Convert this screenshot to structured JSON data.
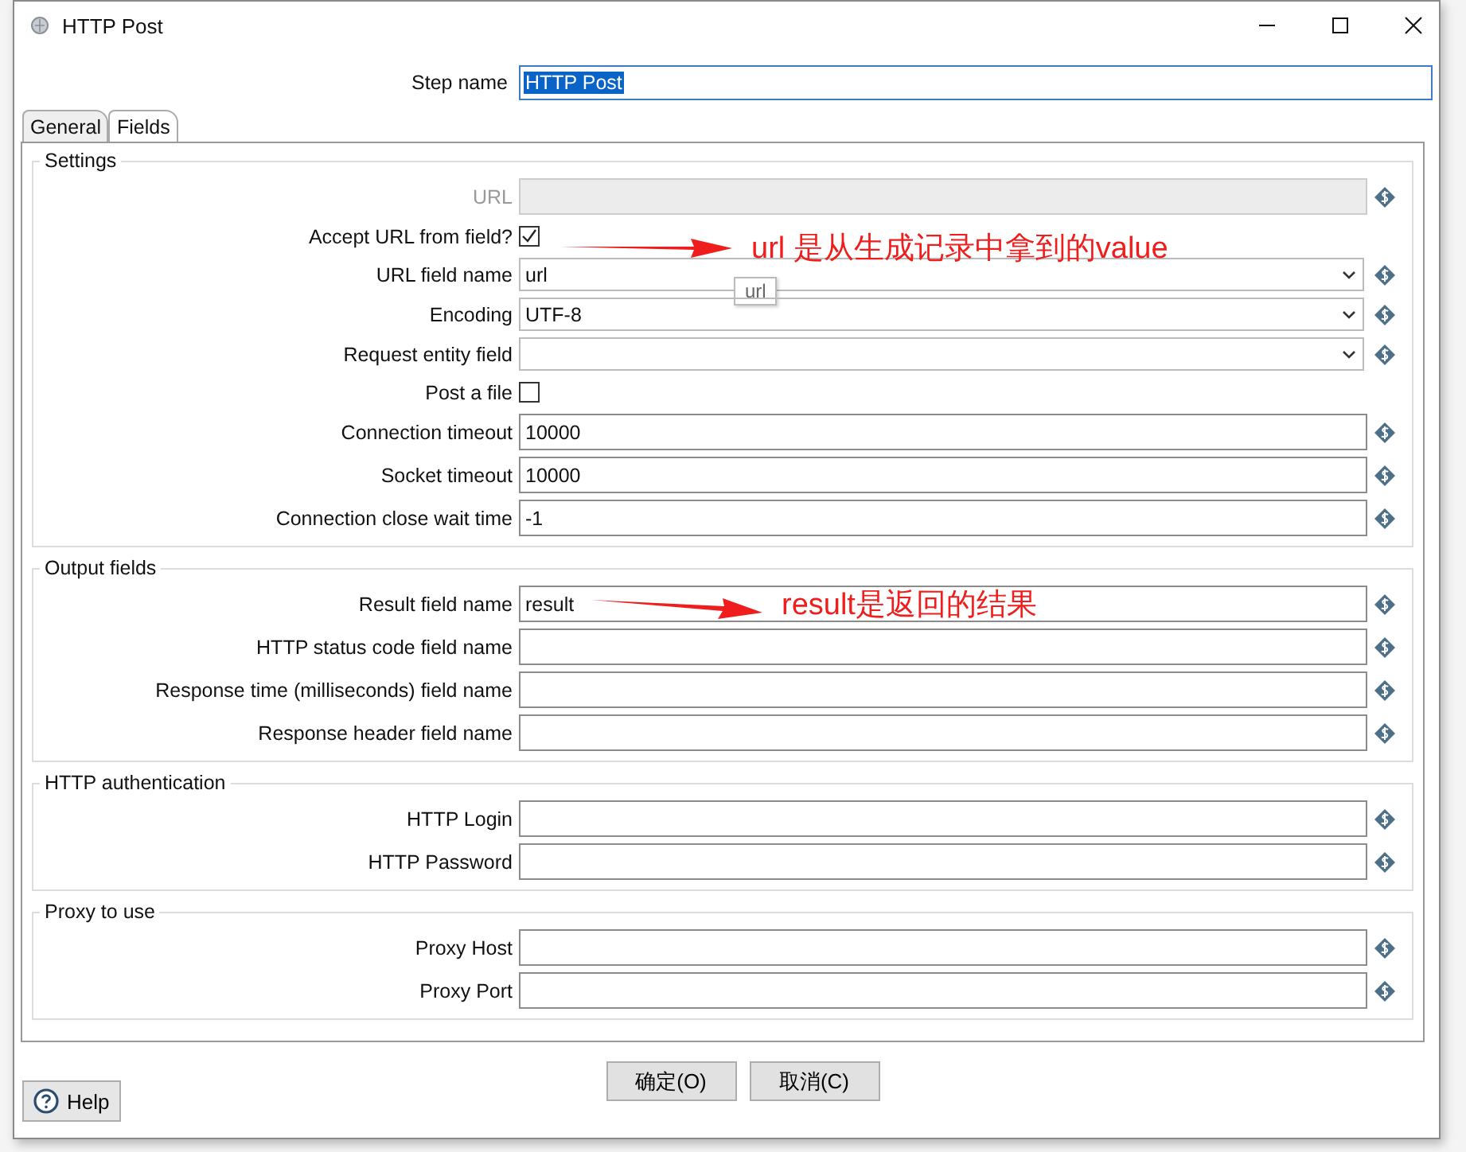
{
  "window": {
    "title": "HTTP Post"
  },
  "step_name": {
    "label": "Step name",
    "value": "HTTP Post"
  },
  "tabs": [
    {
      "label": "General",
      "selected": true
    },
    {
      "label": "Fields",
      "selected": false
    }
  ],
  "groups": [
    {
      "title": "Settings",
      "rows": [
        {
          "kind": "text",
          "label": "URL",
          "value": "",
          "disabled": true
        },
        {
          "kind": "checkbox",
          "label": "Accept URL from field?",
          "checked": true
        },
        {
          "kind": "combo",
          "label": "URL field name",
          "value": "url",
          "tooltip": "url",
          "annotation": "url 是从生成记录中拿到的value"
        },
        {
          "kind": "combo",
          "label": "Encoding",
          "value": "UTF-8"
        },
        {
          "kind": "combo",
          "label": "Request entity field",
          "value": ""
        },
        {
          "kind": "checkbox",
          "label": "Post a file",
          "checked": false
        },
        {
          "kind": "text",
          "label": "Connection timeout",
          "value": "10000",
          "disabled": false
        },
        {
          "kind": "text",
          "label": "Socket timeout",
          "value": "10000",
          "disabled": false
        },
        {
          "kind": "text",
          "label": "Connection close wait time",
          "value": "-1",
          "disabled": false
        }
      ]
    },
    {
      "title": "Output fields",
      "rows": [
        {
          "kind": "text",
          "label": "Result field name",
          "value": "result",
          "disabled": false,
          "annotation": "result是返回的结果"
        },
        {
          "kind": "text",
          "label": "HTTP status code field name",
          "value": "",
          "disabled": false
        },
        {
          "kind": "text",
          "label": "Response time (milliseconds) field name",
          "value": "",
          "disabled": false
        },
        {
          "kind": "text",
          "label": "Response header field name",
          "value": "",
          "disabled": false
        }
      ]
    },
    {
      "title": "HTTP authentication",
      "rows": [
        {
          "kind": "text",
          "label": "HTTP Login",
          "value": "",
          "disabled": false
        },
        {
          "kind": "text",
          "label": "HTTP Password",
          "value": "",
          "disabled": false
        }
      ]
    },
    {
      "title": "Proxy to use",
      "rows": [
        {
          "kind": "text",
          "label": "Proxy Host",
          "value": "",
          "disabled": false
        },
        {
          "kind": "text",
          "label": "Proxy Port",
          "value": "",
          "disabled": false
        }
      ]
    }
  ],
  "help": "Help",
  "buttons": [
    "确定(O)",
    "取消(C)"
  ]
}
